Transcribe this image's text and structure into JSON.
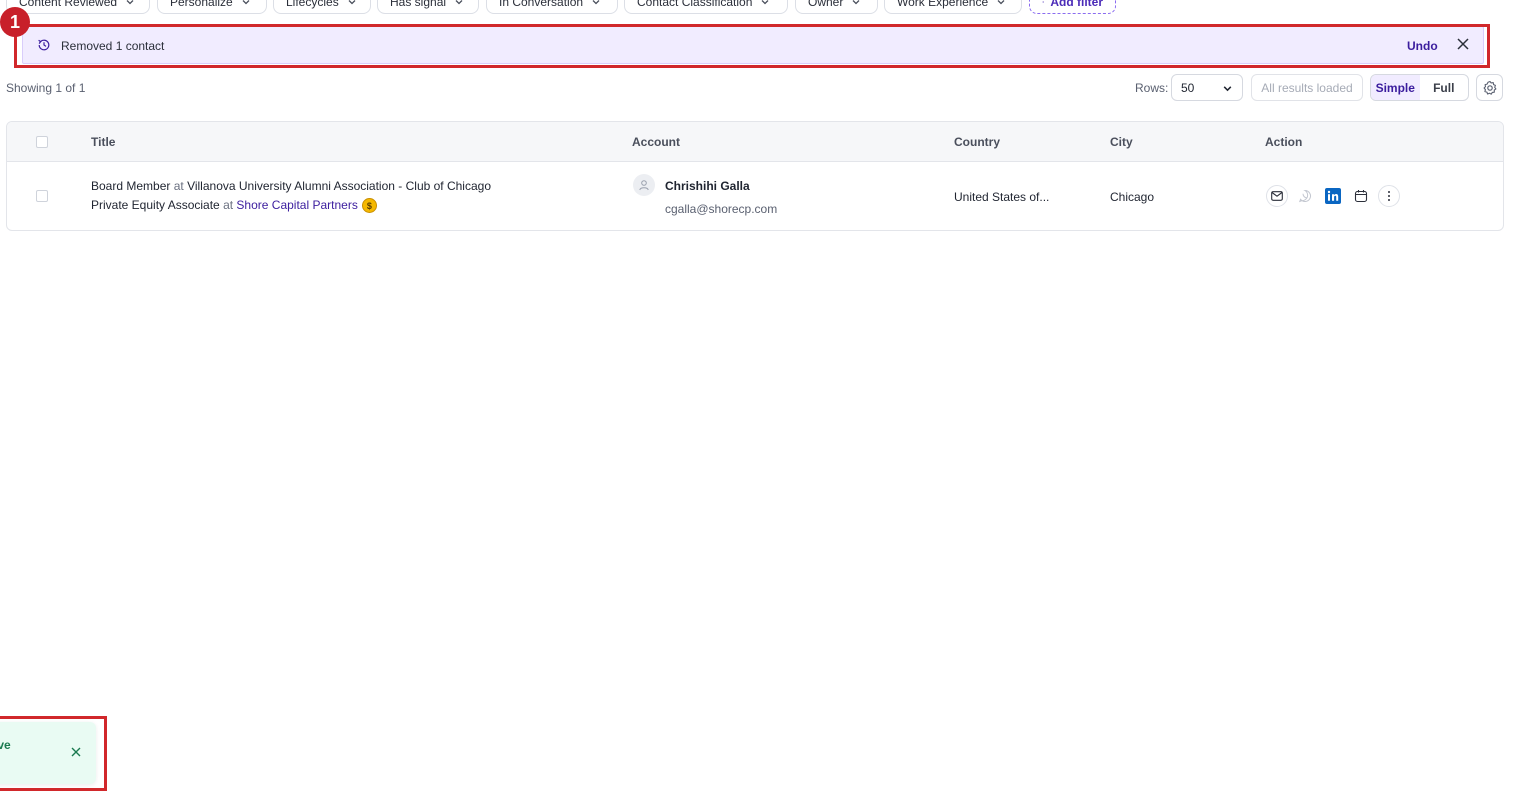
{
  "filters": [
    {
      "label": "Content Reviewed"
    },
    {
      "label": "Personalize"
    },
    {
      "label": "Lifecycles"
    },
    {
      "label": "Has signal"
    },
    {
      "label": "In Conversation"
    },
    {
      "label": "Contact Classification"
    },
    {
      "label": "Owner"
    },
    {
      "label": "Work Experience"
    }
  ],
  "add_filter_label": "Add filter",
  "notification": {
    "message": "Removed 1 contact",
    "undo_label": "Undo",
    "marker": "1"
  },
  "meta": {
    "showing": "Showing 1 of 1",
    "rows_label": "Rows:",
    "rows_value": "50",
    "loaded_label": "All results loaded",
    "view_simple": "Simple",
    "view_full": "Full"
  },
  "table": {
    "headers": {
      "title": "Title",
      "account": "Account",
      "country": "Country",
      "city": "City",
      "action": "Action"
    },
    "row": {
      "title1_role": "Board Member",
      "title1_at": " at ",
      "title1_org": "Villanova University Alumni Association - Club of Chicago",
      "title2_role": "Private Equity Associate",
      "title2_at": " at ",
      "title2_org": "Shore Capital Partners",
      "coin": "$",
      "account_name": "Chrishihi Galla",
      "account_email": "cgalla@shorecp.com",
      "country": "United States of...",
      "city": "Chicago"
    }
  },
  "toast": {
    "text": "ive"
  },
  "colors": {
    "accent": "#3b1d9e",
    "notification_bg": "#f1ecff",
    "highlight": "#d1282b",
    "toast_bg": "#e9fbf3",
    "linkedin": "#0a66c2"
  }
}
